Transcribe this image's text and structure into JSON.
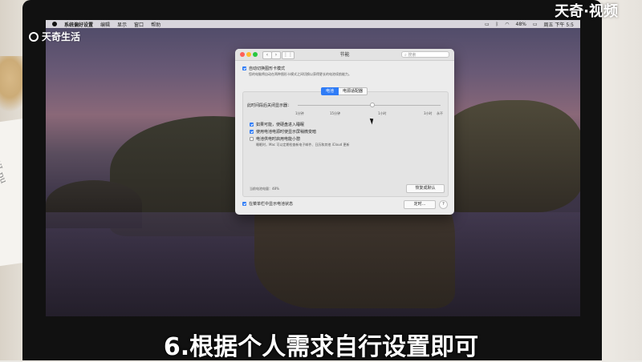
{
  "watermark": {
    "top_left": "天奇生活",
    "top_right": "天奇·视频"
  },
  "paper_text": "WJ pu",
  "menubar": {
    "items": [
      "系统偏好设置",
      "编辑",
      "显示",
      "窗口",
      "帮助"
    ],
    "right": {
      "battery": "48%",
      "clock": "周五 下午 5:5"
    }
  },
  "window": {
    "title": "节能",
    "search_placeholder": "搜索",
    "auto_switch": {
      "label": "自动切换图形卡模式",
      "desc": "您的电脑将自动在两种图形卡模式之间切换以获得更长的电池续航能力。"
    },
    "tabs": [
      {
        "label": "电池",
        "selected": true
      },
      {
        "label": "电源适配器",
        "selected": false
      }
    ],
    "slider": {
      "label": "此时间段后关闭显示器：",
      "ticks": [
        "1分钟",
        "15分钟",
        "1小时",
        "3小时",
        "永不"
      ]
    },
    "options": [
      {
        "label": "如果可能，使硬盘进入睡眠",
        "checked": true
      },
      {
        "label": "使用电池电源时使显示屏稍微变暗",
        "checked": true
      },
      {
        "label": "电池供电时启用电能小憩",
        "checked": false
      }
    ],
    "powernap_desc": "睡眠时，Mac 可以定期检查新电子邮件、日历和其他 iCloud 更新",
    "battery_status": "当前电池电量：48%",
    "restore_button": "恢复成默认",
    "show_status": {
      "label": "在菜单栏中显示电池状态",
      "checked": true
    },
    "schedule_button": "定时...",
    "help_button": "?"
  },
  "caption": "6.根据个人需求自行设置即可"
}
